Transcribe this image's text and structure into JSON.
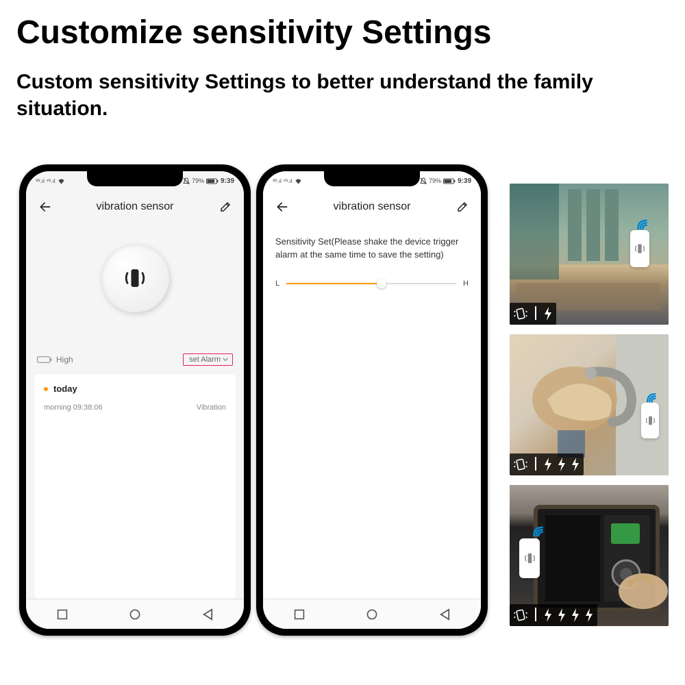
{
  "page": {
    "title": "Customize sensitivity Settings",
    "subtitle": "Custom sensitivity Settings to better understand the family situation."
  },
  "status_bar": {
    "network": "3G 4G",
    "battery_pct": "79%",
    "time": "9:39"
  },
  "phone1": {
    "title": "vibration sensor",
    "battery_label": "High",
    "set_alarm_label": "set Alarm",
    "log": {
      "today_label": "today",
      "entry_time_label": "morning  09:38:06",
      "entry_type": "Vibration"
    }
  },
  "phone2": {
    "title": "vibration sensor",
    "sensitivity_text": "Sensitivity Set(Please shake the device trigger alarm at the same time to save the setting)",
    "slider_low": "L",
    "slider_high": "H",
    "slider_value_pct": 55
  },
  "scenes": [
    {
      "name": "living-room-curtain",
      "bolts": 1
    },
    {
      "name": "door-handle",
      "bolts": 3
    },
    {
      "name": "safe-box",
      "bolts": 4
    }
  ]
}
